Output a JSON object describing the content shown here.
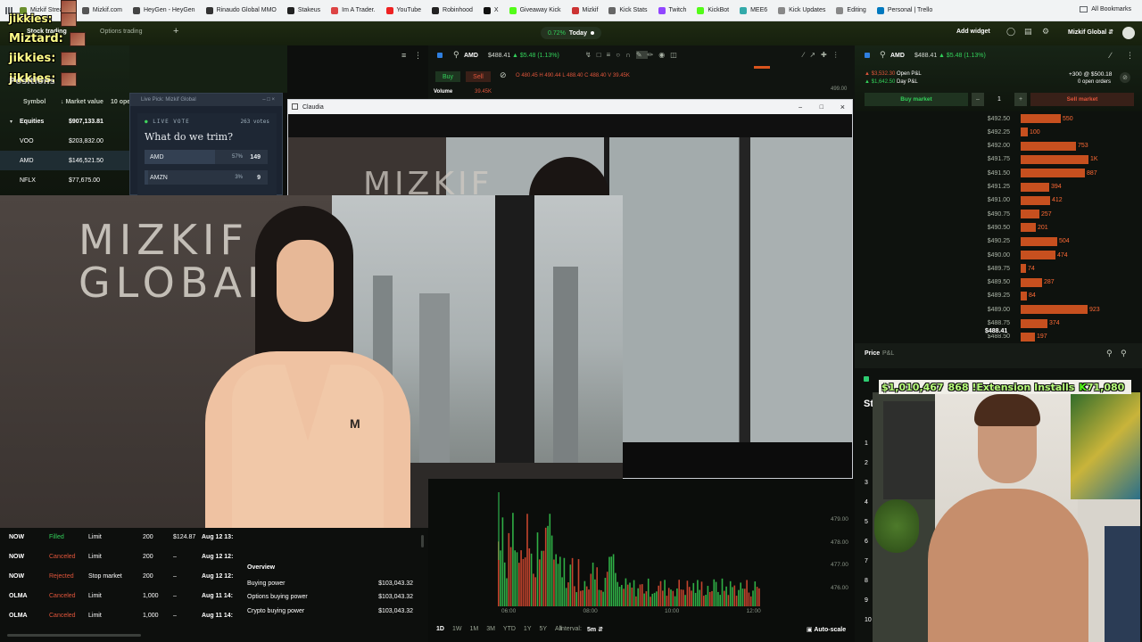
{
  "bookmarks": {
    "items": [
      {
        "label": "Mizkif Streams",
        "color": "#6b8f2e"
      },
      {
        "label": "Mizkif.com",
        "color": "#555555"
      },
      {
        "label": "HeyGen - HeyGen",
        "color": "#444444"
      },
      {
        "label": "Rinaudo Global MMO",
        "color": "#333333"
      },
      {
        "label": "Stakeus",
        "color": "#222222"
      },
      {
        "label": "Im A Trader.",
        "color": "#d44"
      },
      {
        "label": "YouTube",
        "color": "#e22"
      },
      {
        "label": "Robinhood",
        "color": "#222"
      },
      {
        "label": "X",
        "color": "#111"
      },
      {
        "label": "Giveaway Kick",
        "color": "#53fc18"
      },
      {
        "label": "Mizkif",
        "color": "#c33"
      },
      {
        "label": "Kick Stats",
        "color": "#666"
      },
      {
        "label": "Twitch",
        "color": "#9146ff"
      },
      {
        "label": "KickBot",
        "color": "#53fc18"
      },
      {
        "label": "MEE6",
        "color": "#3aa"
      },
      {
        "label": "Kick Updates",
        "color": "#888"
      },
      {
        "label": "Editing",
        "color": "#888"
      },
      {
        "label": "Personal | Trello",
        "color": "#0079bf"
      }
    ],
    "all_bookmarks": "All Bookmarks"
  },
  "topbar": {
    "stock_trading": "Stock trading",
    "options_trading": "Options trading",
    "today_change": "0.72%",
    "today_label": "Today",
    "add_widget": "Add widget",
    "account": "Mizkif Global"
  },
  "chat": [
    {
      "name": "jikkies:"
    },
    {
      "name": "Miztard:"
    },
    {
      "name": "jikkies:"
    },
    {
      "name": "jikkies:"
    },
    {
      "name": "Positions"
    }
  ],
  "positions": {
    "headers": [
      "Symbol",
      "Market value",
      "10 ope"
    ],
    "group": "Equities",
    "group_value": "$907,133.81",
    "rows": [
      {
        "symbol": "VOO",
        "value": "$203,832.00"
      },
      {
        "symbol": "AMD",
        "value": "$146,521.50"
      },
      {
        "symbol": "NFLX",
        "value": "$77,675.00"
      }
    ]
  },
  "vote": {
    "window_title": "Live Pick: Mizkif Global",
    "badge": "LIVE VOTE",
    "votes": "263 votes",
    "question": "What do we trim?",
    "options": [
      {
        "ticker": "AMD",
        "pct": "57%",
        "count": "149",
        "fill": 0.57
      },
      {
        "ticker": "AMZN",
        "pct": "3%",
        "count": "9",
        "fill": 0.03
      }
    ]
  },
  "chart_header": {
    "symbol": "AMD",
    "price": "$488.41",
    "change": "▲ $5.48 (1.13%)",
    "buy": "Buy",
    "sell": "Sell",
    "ohlc": "O 480.45 H 490.44 L 488.40 C 488.40 V 39.45K",
    "volume_label": "Volume",
    "volume_value": "39.45K",
    "price_tick_top": "499.00"
  },
  "claudia": {
    "title": "Claudia"
  },
  "right_panel": {
    "symbol": "AMD",
    "price": "$488.41",
    "change": "▲ $5.48 (1.13%)",
    "open_pnl": "▲ $3,532.30",
    "open_pnl_label": "Open P&L",
    "day_pnl": "▲ $1,642.50",
    "day_pnl_label": "Day P&L",
    "position": "+300 @ $500.18",
    "open_orders": "0 open orders",
    "buy_market": "Buy market",
    "sell_market": "Sell market",
    "qty": "1",
    "price_tab": "Price",
    "pnl_tab": "P&L",
    "current_price": "$488.41"
  },
  "order_book": [
    {
      "price": "$492.50",
      "size": "550",
      "fill": 0.59
    },
    {
      "price": "$492.25",
      "size": "100",
      "fill": 0.11
    },
    {
      "price": "$492.00",
      "size": "753",
      "fill": 0.81
    },
    {
      "price": "$491.75",
      "size": "1K",
      "fill": 1.0
    },
    {
      "price": "$491.50",
      "size": "887",
      "fill": 0.95
    },
    {
      "price": "$491.25",
      "size": "394",
      "fill": 0.42
    },
    {
      "price": "$491.00",
      "size": "412",
      "fill": 0.44
    },
    {
      "price": "$490.75",
      "size": "257",
      "fill": 0.28
    },
    {
      "price": "$490.50",
      "size": "201",
      "fill": 0.22
    },
    {
      "price": "$490.25",
      "size": "504",
      "fill": 0.54
    },
    {
      "price": "$490.00",
      "size": "474",
      "fill": 0.51
    },
    {
      "price": "$489.75",
      "size": "74",
      "fill": 0.08
    },
    {
      "price": "$489.50",
      "size": "287",
      "fill": 0.31
    },
    {
      "price": "$489.25",
      "size": "84",
      "fill": 0.09
    },
    {
      "price": "$489.00",
      "size": "923",
      "fill": 0.99
    },
    {
      "price": "$488.75",
      "size": "374",
      "fill": 0.4
    },
    {
      "price": "$488.50",
      "size": "197",
      "fill": 0.21
    }
  ],
  "orders": [
    {
      "symbol": "NOW",
      "status": "Filled",
      "type": "Limit",
      "qty": "200",
      "price": "$124.87",
      "date": "Aug 12 13:"
    },
    {
      "symbol": "NOW",
      "status": "Canceled",
      "type": "Limit",
      "qty": "200",
      "price": "–",
      "date": "Aug 12 12:"
    },
    {
      "symbol": "NOW",
      "status": "Rejected",
      "type": "Stop market",
      "qty": "200",
      "price": "–",
      "date": "Aug 12 12:"
    },
    {
      "symbol": "OLMA",
      "status": "Canceled",
      "type": "Limit",
      "qty": "1,000",
      "price": "–",
      "date": "Aug 11 14:"
    },
    {
      "symbol": "OLMA",
      "status": "Canceled",
      "type": "Limit",
      "qty": "1,000",
      "price": "–",
      "date": "Aug 11 14:"
    }
  ],
  "overview": {
    "title": "Overview",
    "rows": [
      {
        "label": "Buying power",
        "value": "$103,043.32"
      },
      {
        "label": "Options buying power",
        "value": "$103,043.32"
      },
      {
        "label": "Crypto buying power",
        "value": "$103,043.32"
      }
    ]
  },
  "chart_bottom": {
    "price_ticks": [
      "479.00",
      "478.00",
      "477.00",
      "476.00"
    ],
    "time_ticks": [
      "06:00",
      "08:00",
      "10:00",
      "12:00"
    ],
    "ranges": [
      "1D",
      "1W",
      "1M",
      "3M",
      "YTD",
      "1Y",
      "5Y",
      "All"
    ],
    "interval_label": "Interval:",
    "interval_value": "5m",
    "auto_scale": "Auto-scale"
  },
  "watch_numbers": [
    "1",
    "2",
    "3",
    "4",
    "5",
    "6",
    "7",
    "8",
    "9",
    "10"
  ],
  "stream_stats": {
    "followers": "$1,010,467",
    "command": "868 !Extension Installs",
    "subs": "71,080"
  },
  "colors": {
    "accent_green": "#33d05a",
    "accent_red": "#e0553b",
    "bar_orange": "#c7501f"
  }
}
